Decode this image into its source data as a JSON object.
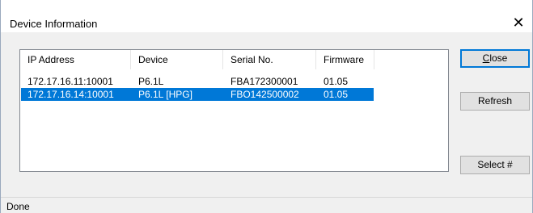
{
  "window": {
    "title": "Device Information",
    "close_glyph": "✕"
  },
  "list": {
    "columns": [
      "IP Address",
      "Device",
      "Serial No.",
      "Firmware"
    ],
    "rows": [
      {
        "ip": "172.17.16.11:10001",
        "device": "P6.1L",
        "serial": "FBA172300001",
        "firmware": "01.05",
        "selected": false
      },
      {
        "ip": "172.17.16.14:10001",
        "device": "P6.1L [HPG]",
        "serial": "FBO142500002",
        "firmware": "01.05",
        "selected": true
      }
    ]
  },
  "buttons": {
    "close_first": "C",
    "close_rest": "lose",
    "refresh": "Refresh",
    "select": "Select #"
  },
  "status": {
    "text": "Done"
  },
  "colors": {
    "selection": "#0078d7",
    "button_face": "#e1e1e1",
    "dialog_face": "#f0f0f0"
  }
}
